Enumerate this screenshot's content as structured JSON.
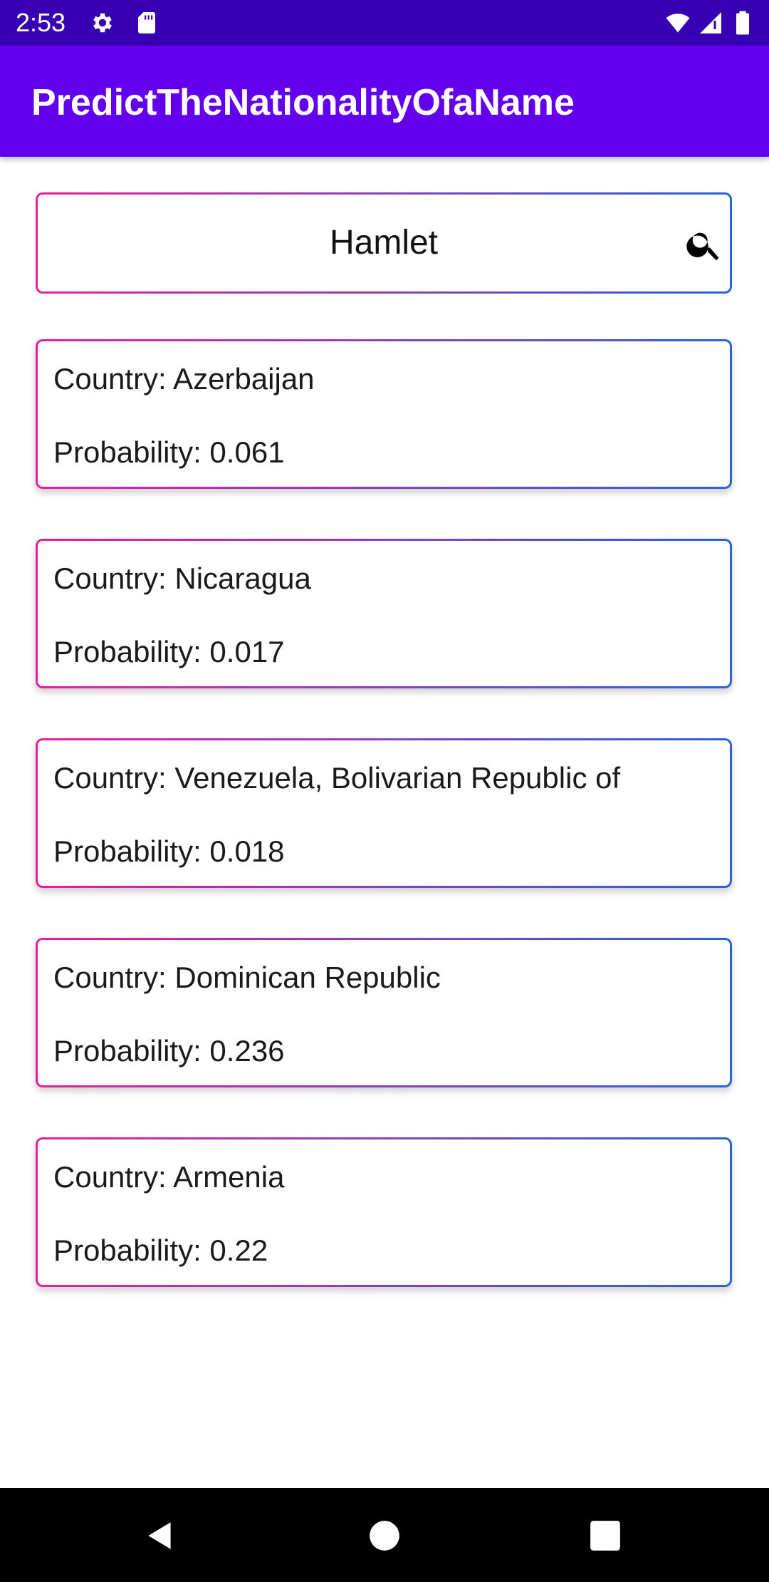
{
  "status_bar": {
    "time": "2:53",
    "icons": [
      "gear-icon",
      "sd-card-icon",
      "wifi-icon",
      "cell-signal-icon",
      "battery-icon"
    ]
  },
  "app_bar": {
    "title": "PredictTheNationalityOfaName"
  },
  "search": {
    "value": "Hamlet",
    "icon": "search-icon"
  },
  "results": [
    {
      "country": "Country: Azerbaijan",
      "probability": "Probability: 0.061"
    },
    {
      "country": "Country: Nicaragua",
      "probability": "Probability: 0.017"
    },
    {
      "country": "Country: Venezuela, Bolivarian Republic of",
      "probability": "Probability: 0.018"
    },
    {
      "country": "Country: Dominican Republic",
      "probability": "Probability: 0.236"
    },
    {
      "country": "Country: Armenia",
      "probability": "Probability: 0.22"
    }
  ],
  "nav_bar": {
    "buttons": [
      "back-icon",
      "home-icon",
      "recents-icon"
    ]
  },
  "colors": {
    "status_bar": "#3700b3",
    "app_bar": "#6200ee",
    "border_start": "#e91e9b",
    "border_end": "#2962d9"
  }
}
